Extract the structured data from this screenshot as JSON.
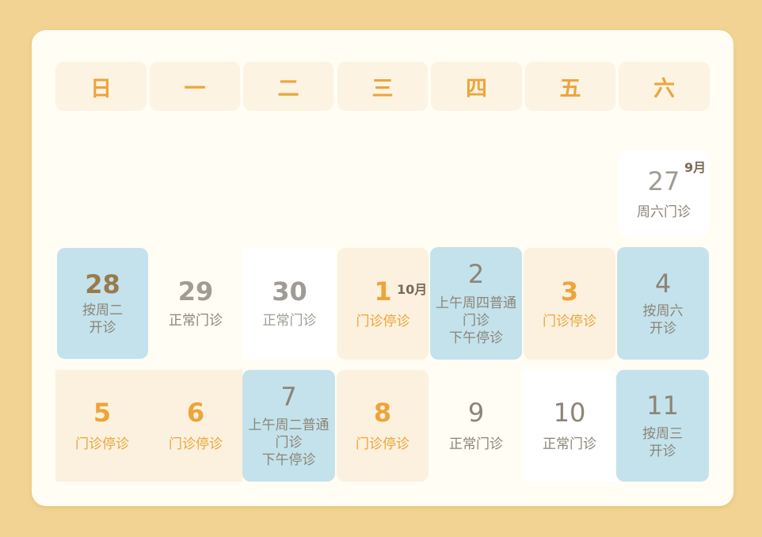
{
  "weekdays": [
    "日",
    "一",
    "二",
    "三",
    "四",
    "五",
    "六"
  ],
  "days": {
    "d27": {
      "num": "27",
      "month": "9月",
      "note": "周六门诊"
    },
    "d28": {
      "num": "28",
      "note1": "按周二",
      "note2": "开诊"
    },
    "d29": {
      "num": "29",
      "note": "正常门诊"
    },
    "d30": {
      "num": "30",
      "note": "正常门诊"
    },
    "d1": {
      "num": "1",
      "month": "10月",
      "note": "门诊停诊"
    },
    "d2": {
      "num": "2",
      "note1": "上午周四普通",
      "note2": "门诊",
      "note3": "下午停诊"
    },
    "d3": {
      "num": "3",
      "note": "门诊停诊"
    },
    "d4": {
      "num": "4",
      "note1": "按周六",
      "note2": "开诊"
    },
    "d5": {
      "num": "5",
      "note": "门诊停诊"
    },
    "d6": {
      "num": "6",
      "note": "门诊停诊"
    },
    "d7": {
      "num": "7",
      "note1": "上午周二普通",
      "note2": "门诊",
      "note3": "下午停诊"
    },
    "d8": {
      "num": "8",
      "note": "门诊停诊"
    },
    "d9": {
      "num": "9",
      "note": "正常门诊"
    },
    "d10": {
      "num": "10",
      "note": "正常门诊"
    },
    "d11": {
      "num": "11",
      "note1": "按周三",
      "note2": "开诊"
    }
  },
  "colors": {
    "page_bg": "#f3d393",
    "card_bg": "#fffdf4",
    "header_bg": "#fcf3e3",
    "accent_orange": "#eda43a",
    "adjusted_blue": "#c3e2ec",
    "holiday_peach": "#fcf1de"
  }
}
